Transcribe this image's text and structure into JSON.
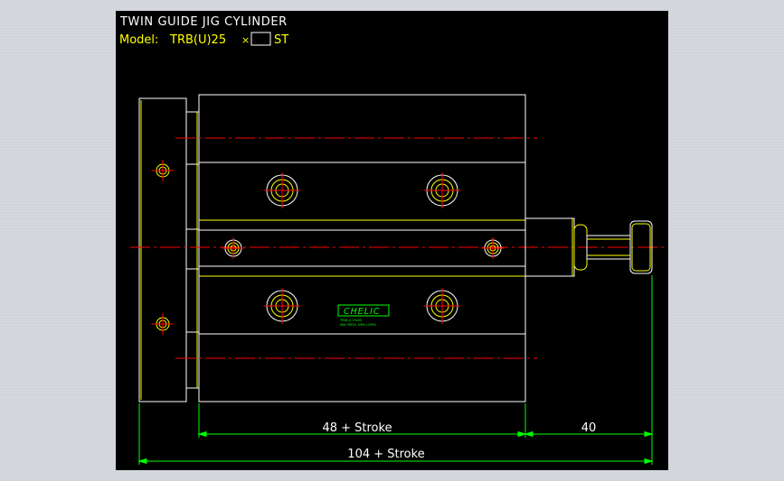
{
  "drawing": {
    "title": "TWIN GUIDE JIG CYLINDER",
    "model_prefix": "Model:",
    "model_code": "TRB(U)25",
    "model_times": "×",
    "model_suffix": "ST"
  },
  "logo": {
    "brand": "CHELIC",
    "fine_print_1": "TRB(U) 25x50",
    "fine_print_2": "MAX PRESS 1MPa 145PSI"
  },
  "dimensions": {
    "body_length": "48 + Stroke",
    "rod_extension": "40",
    "overall_length": "104 + Stroke"
  },
  "colors": {
    "background": "#000000",
    "outline": "#ffffff",
    "part": "#ffff00",
    "centerline": "#ff0000",
    "dimension": "#00ff00",
    "label": "#ffffff",
    "model_label": "#ffff00"
  }
}
